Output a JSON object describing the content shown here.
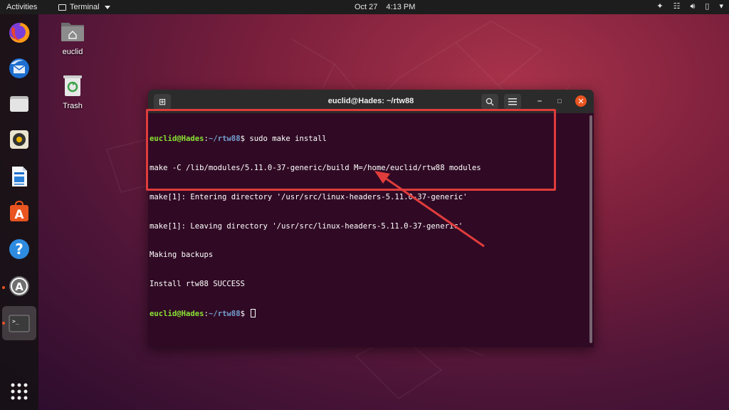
{
  "topbar": {
    "activities": "Activities",
    "app_name": "Terminal",
    "date": "Oct 27",
    "time": "4:13 PM",
    "tray_icons": [
      "slack-icon",
      "network-icon",
      "volume-icon",
      "battery-icon",
      "power-menu-icon"
    ]
  },
  "dock": {
    "items": [
      "firefox-icon",
      "thunderbird-icon",
      "files-icon",
      "rhythmbox-icon",
      "writer-icon",
      "software-icon",
      "help-icon",
      "software-updater-icon",
      "terminal-icon",
      "show-apps-icon"
    ]
  },
  "desktop": {
    "home_label": "euclid",
    "trash_label": "Trash"
  },
  "terminal": {
    "title": "euclid@Hades: ~/rtw88",
    "lines": [
      {
        "user": "euclid@Hades",
        "path": "~/rtw88",
        "cmd": "sudo make install"
      },
      {
        "text": "make -C /lib/modules/5.11.0-37-generic/build M=/home/euclid/rtw88 modules"
      },
      {
        "text": "make[1]: Entering directory '/usr/src/linux-headers-5.11.0-37-generic'"
      },
      {
        "text": "make[1]: Leaving directory '/usr/src/linux-headers-5.11.0-37-generic'"
      },
      {
        "text": "Making backups"
      },
      {
        "text": "Install rtw88 SUCCESS"
      },
      {
        "user": "euclid@Hades",
        "path": "~/rtw88",
        "cmd": ""
      }
    ]
  },
  "colors": {
    "annotation": "#e03c3c",
    "prompt_user": "#8ae234",
    "prompt_path": "#729fcf",
    "terminal_bg": "#300a24"
  }
}
